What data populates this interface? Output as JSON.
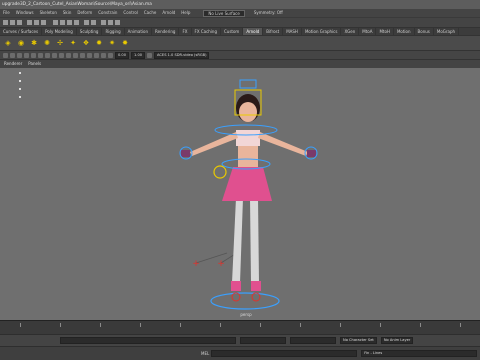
{
  "title": "upgrade3D_2_Cartoon_CuteI_AsianWoman\\Source\\Maya_ori\\Asian.ma",
  "menu": [
    "File",
    "Windows",
    "Skeleton",
    "Skin",
    "Deform",
    "Constrain",
    "Control",
    "Cache",
    "Arnold",
    "Help"
  ],
  "surface_select": "No Live Surface",
  "symmetry": "Symmetry: Off",
  "shelf_tabs": [
    "Curves / Surfaces",
    "Poly Modeling",
    "Sculpting",
    "Rigging",
    "Animation",
    "Rendering",
    "FX",
    "FX Caching",
    "Custom",
    "Arnold",
    "Bifrost",
    "MASH",
    "Motion Graphics",
    "XGen",
    "MtoA",
    "MtoH",
    "Motion",
    "Bonus",
    "MoGraph"
  ],
  "active_tab": "Arnold",
  "panel": {
    "fields": {
      "near": "0.00",
      "far": "1.00"
    },
    "color_space": "ACES 1.0 SDR-video (sRGB)",
    "menus": [
      "Renderer",
      "Panels"
    ]
  },
  "viewport": {
    "camera_label": "persp"
  },
  "range_bar": {
    "character_set": "No Character Set",
    "anim_layer": "No Anim Layer"
  },
  "cmdline": {
    "lang": "MEL",
    "input": "",
    "result": "Fin - Lines"
  },
  "colors": {
    "viewport_bg": "#6f6f6f",
    "shelf_icon": "#eaca00",
    "skirt": "#e0508f",
    "stockings": "#d8d8d8",
    "control_blue": "#3aa0ff",
    "control_red": "#e0322c"
  }
}
